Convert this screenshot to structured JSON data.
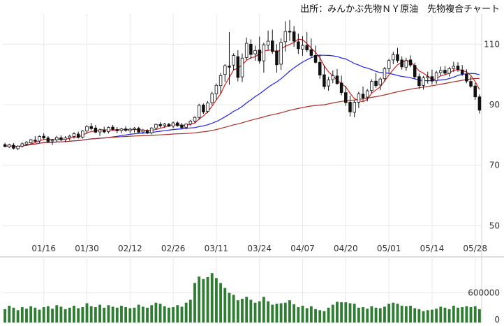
{
  "source": "出所：みんかぶ先物ＮＹ原油　先物複合チャート",
  "chart_data": {
    "type": "candlestick",
    "title": "",
    "price_axis": {
      "ticks": [
        50,
        70,
        90,
        110
      ],
      "ylim": [
        42,
        120
      ]
    },
    "volume_axis": {
      "ticks": [
        0,
        600000
      ],
      "ylim": [
        0,
        1300000
      ]
    },
    "x_ticks": [
      "01/16",
      "01/30",
      "02/12",
      "02/26",
      "03/11",
      "03/24",
      "04/07",
      "04/20",
      "05/01",
      "05/14",
      "05/28"
    ],
    "x_tick_indices": [
      9,
      19,
      29,
      39,
      49,
      59,
      69,
      79,
      89,
      99,
      109
    ],
    "candles": [
      [
        0,
        76.8,
        77.4,
        75.9,
        76.2
      ],
      [
        1,
        76.0,
        77.1,
        75.7,
        76.8
      ],
      [
        2,
        76.6,
        77.3,
        75.2,
        75.6
      ],
      [
        3,
        75.5,
        76.6,
        75.0,
        76.3
      ],
      [
        4,
        76.3,
        77.6,
        75.8,
        77.1
      ],
      [
        5,
        77.0,
        78.0,
        76.4,
        77.6
      ],
      [
        6,
        77.4,
        78.7,
        77.0,
        78.4
      ],
      [
        7,
        78.3,
        79.6,
        77.6,
        77.9
      ],
      [
        8,
        78.0,
        79.8,
        77.4,
        79.5
      ],
      [
        9,
        79.6,
        80.6,
        78.6,
        79.0
      ],
      [
        10,
        79.0,
        79.6,
        77.6,
        77.8
      ],
      [
        11,
        78.0,
        78.7,
        76.7,
        78.3
      ],
      [
        12,
        78.4,
        79.7,
        77.6,
        79.2
      ],
      [
        13,
        79.1,
        79.9,
        78.0,
        78.4
      ],
      [
        14,
        78.5,
        79.6,
        77.6,
        79.0
      ],
      [
        15,
        79.0,
        80.1,
        78.2,
        79.6
      ],
      [
        16,
        79.5,
        80.9,
        78.8,
        80.4
      ],
      [
        17,
        80.3,
        81.1,
        78.8,
        79.2
      ],
      [
        18,
        79.3,
        81.6,
        78.8,
        81.3
      ],
      [
        19,
        81.3,
        83.2,
        80.4,
        82.8
      ],
      [
        20,
        82.8,
        84.0,
        81.6,
        82.1
      ],
      [
        21,
        82.3,
        83.3,
        80.6,
        80.9
      ],
      [
        22,
        81.0,
        82.1,
        79.7,
        81.7
      ],
      [
        23,
        81.6,
        82.7,
        80.6,
        81.0
      ],
      [
        24,
        81.1,
        82.8,
        80.5,
        82.5
      ],
      [
        25,
        82.6,
        83.3,
        81.4,
        81.8
      ],
      [
        26,
        81.8,
        82.6,
        80.6,
        81.4
      ],
      [
        27,
        81.5,
        82.3,
        80.6,
        82.0
      ],
      [
        28,
        82.0,
        82.9,
        81.1,
        81.5
      ],
      [
        29,
        81.4,
        82.4,
        80.6,
        81.9
      ],
      [
        30,
        81.9,
        82.6,
        80.8,
        82.3
      ],
      [
        31,
        82.2,
        82.7,
        80.7,
        80.9
      ],
      [
        32,
        81.0,
        82.0,
        80.4,
        81.6
      ],
      [
        33,
        81.5,
        81.9,
        80.3,
        80.6
      ],
      [
        34,
        80.7,
        82.6,
        80.2,
        82.3
      ],
      [
        35,
        82.3,
        83.8,
        81.8,
        83.5
      ],
      [
        36,
        83.5,
        84.2,
        82.4,
        83.0
      ],
      [
        37,
        83.1,
        84.0,
        82.3,
        83.6
      ],
      [
        38,
        83.5,
        84.0,
        82.6,
        82.9
      ],
      [
        39,
        82.9,
        84.4,
        82.2,
        84.0
      ],
      [
        40,
        84.0,
        84.5,
        82.7,
        83.1
      ],
      [
        41,
        83.3,
        84.0,
        82.0,
        82.4
      ],
      [
        42,
        82.5,
        83.8,
        81.9,
        83.6
      ],
      [
        43,
        83.6,
        85.0,
        83.0,
        84.6
      ],
      [
        44,
        84.6,
        86.2,
        84.0,
        85.8
      ],
      [
        45,
        85.8,
        90.3,
        85.0,
        89.8
      ],
      [
        46,
        89.9,
        90.4,
        87.0,
        87.6
      ],
      [
        47,
        87.8,
        91.2,
        87.2,
        90.6
      ],
      [
        48,
        90.7,
        94.3,
        89.9,
        93.6
      ],
      [
        49,
        93.6,
        97.0,
        91.6,
        96.4
      ],
      [
        50,
        96.3,
        100.5,
        93.6,
        99.6
      ],
      [
        51,
        100.0,
        103.4,
        97.6,
        102.9
      ],
      [
        52,
        102.8,
        114.0,
        96.6,
        102.4
      ],
      [
        53,
        103.1,
        107.0,
        101.5,
        106.3
      ],
      [
        54,
        105.9,
        108.0,
        97.7,
        99.0
      ],
      [
        55,
        99.2,
        106.9,
        97.5,
        105.4
      ],
      [
        56,
        105.6,
        112.2,
        104.8,
        110.3
      ],
      [
        57,
        110.0,
        111.6,
        105.1,
        106.6
      ],
      [
        58,
        106.8,
        109.5,
        104.5,
        107.9
      ],
      [
        59,
        108.1,
        112.5,
        103.6,
        104.5
      ],
      [
        60,
        104.5,
        110.5,
        100.6,
        109.8
      ],
      [
        61,
        109.7,
        114.5,
        108.0,
        111.0
      ],
      [
        62,
        111.1,
        114.8,
        106.8,
        107.6
      ],
      [
        63,
        107.8,
        110.0,
        100.6,
        103.2
      ],
      [
        64,
        103.4,
        111.9,
        101.5,
        110.6
      ],
      [
        65,
        110.8,
        117.6,
        107.6,
        114.2
      ],
      [
        66,
        114.3,
        118.0,
        111.1,
        114.0
      ],
      [
        67,
        114.1,
        116.0,
        109.1,
        111.0
      ],
      [
        68,
        110.8,
        113.5,
        106.8,
        108.5
      ],
      [
        69,
        108.4,
        112.7,
        106.2,
        109.6
      ],
      [
        70,
        109.6,
        114.0,
        107.4,
        108.1
      ],
      [
        71,
        108.2,
        111.9,
        105.8,
        106.3
      ],
      [
        72,
        106.3,
        109.5,
        103.6,
        104.0
      ],
      [
        73,
        104.0,
        106.6,
        98.6,
        99.8
      ],
      [
        74,
        99.9,
        103.0,
        95.1,
        96.0
      ],
      [
        75,
        96.2,
        99.2,
        94.6,
        98.2
      ],
      [
        76,
        98.3,
        101.3,
        97.1,
        99.6
      ],
      [
        77,
        99.5,
        101.8,
        96.6,
        97.0
      ],
      [
        78,
        97.2,
        99.6,
        93.1,
        94.0
      ],
      [
        79,
        94.0,
        96.2,
        89.6,
        90.7
      ],
      [
        80,
        90.8,
        93.0,
        86.1,
        87.6
      ],
      [
        81,
        87.5,
        91.5,
        85.8,
        90.8
      ],
      [
        82,
        90.8,
        94.3,
        88.9,
        93.6
      ],
      [
        83,
        93.5,
        96.0,
        91.2,
        92.3
      ],
      [
        84,
        92.5,
        95.2,
        91.1,
        94.6
      ],
      [
        85,
        94.7,
        98.4,
        93.8,
        97.7
      ],
      [
        86,
        97.8,
        100.4,
        95.6,
        96.3
      ],
      [
        87,
        96.5,
        99.1,
        94.8,
        98.5
      ],
      [
        88,
        98.6,
        102.5,
        97.6,
        101.9
      ],
      [
        89,
        101.9,
        105.2,
        100.6,
        104.6
      ],
      [
        90,
        104.8,
        107.5,
        103.4,
        106.5
      ],
      [
        91,
        106.6,
        108.8,
        103.9,
        104.6
      ],
      [
        92,
        104.8,
        106.0,
        101.6,
        102.5
      ],
      [
        93,
        102.4,
        105.5,
        101.2,
        104.6
      ],
      [
        94,
        104.8,
        106.3,
        102.4,
        103.1
      ],
      [
        95,
        103.0,
        103.9,
        98.4,
        99.2
      ],
      [
        96,
        99.3,
        100.3,
        95.2,
        96.3
      ],
      [
        97,
        96.4,
        99.5,
        95.0,
        98.9
      ],
      [
        98,
        98.9,
        100.9,
        97.0,
        99.3
      ],
      [
        99,
        99.3,
        101.6,
        96.7,
        97.8
      ],
      [
        100,
        97.9,
        101.2,
        96.9,
        100.6
      ],
      [
        101,
        100.6,
        102.6,
        99.6,
        101.3
      ],
      [
        102,
        101.4,
        102.8,
        99.8,
        100.4
      ],
      [
        103,
        100.4,
        102.5,
        99.3,
        101.9
      ],
      [
        104,
        101.9,
        104.2,
        100.8,
        102.7
      ],
      [
        105,
        102.8,
        104.0,
        100.9,
        101.6
      ],
      [
        106,
        101.5,
        103.1,
        99.5,
        100.2
      ],
      [
        107,
        100.1,
        101.7,
        97.1,
        97.8
      ],
      [
        108,
        97.7,
        99.3,
        95.6,
        96.1
      ],
      [
        109,
        96.2,
        97.2,
        91.6,
        92.6
      ],
      [
        110,
        92.6,
        93.4,
        87.1,
        88.2
      ]
    ],
    "volume": [
      [
        0,
        270000
      ],
      [
        1,
        340000
      ],
      [
        2,
        300000
      ],
      [
        3,
        250000
      ],
      [
        4,
        310000
      ],
      [
        5,
        280000
      ],
      [
        6,
        330000
      ],
      [
        7,
        300000
      ],
      [
        8,
        260000
      ],
      [
        9,
        310000
      ],
      [
        10,
        330000
      ],
      [
        11,
        280000
      ],
      [
        12,
        350000
      ],
      [
        13,
        320000
      ],
      [
        14,
        270000
      ],
      [
        15,
        300000
      ],
      [
        16,
        340000
      ],
      [
        17,
        290000
      ],
      [
        18,
        310000
      ],
      [
        19,
        390000
      ],
      [
        20,
        330000
      ],
      [
        21,
        310000
      ],
      [
        22,
        360000
      ],
      [
        23,
        300000
      ],
      [
        24,
        350000
      ],
      [
        25,
        320000
      ],
      [
        26,
        300000
      ],
      [
        27,
        340000
      ],
      [
        28,
        310000
      ],
      [
        29,
        290000
      ],
      [
        30,
        300000
      ],
      [
        31,
        360000
      ],
      [
        32,
        320000
      ],
      [
        33,
        300000
      ],
      [
        34,
        350000
      ],
      [
        35,
        400000
      ],
      [
        36,
        380000
      ],
      [
        37,
        330000
      ],
      [
        38,
        300000
      ],
      [
        39,
        310000
      ],
      [
        40,
        350000
      ],
      [
        41,
        320000
      ],
      [
        42,
        400000
      ],
      [
        43,
        460000
      ],
      [
        44,
        800000
      ],
      [
        45,
        930000
      ],
      [
        46,
        880000
      ],
      [
        47,
        920000
      ],
      [
        48,
        1000000
      ],
      [
        49,
        900000
      ],
      [
        50,
        800000
      ],
      [
        51,
        700000
      ],
      [
        52,
        600000
      ],
      [
        53,
        560000
      ],
      [
        54,
        450000
      ],
      [
        55,
        480000
      ],
      [
        56,
        520000
      ],
      [
        57,
        460000
      ],
      [
        58,
        400000
      ],
      [
        59,
        430000
      ],
      [
        60,
        520000
      ],
      [
        61,
        430000
      ],
      [
        62,
        360000
      ],
      [
        63,
        380000
      ],
      [
        64,
        390000
      ],
      [
        65,
        400000
      ],
      [
        66,
        450000
      ],
      [
        67,
        370000
      ],
      [
        68,
        310000
      ],
      [
        69,
        340000
      ],
      [
        70,
        290000
      ],
      [
        71,
        330000
      ],
      [
        72,
        270000
      ],
      [
        73,
        250000
      ],
      [
        74,
        230000
      ],
      [
        75,
        300000
      ],
      [
        76,
        360000
      ],
      [
        77,
        420000
      ],
      [
        78,
        410000
      ],
      [
        79,
        410000
      ],
      [
        80,
        390000
      ],
      [
        81,
        380000
      ],
      [
        82,
        300000
      ],
      [
        83,
        310000
      ],
      [
        84,
        280000
      ],
      [
        85,
        330000
      ],
      [
        86,
        300000
      ],
      [
        87,
        290000
      ],
      [
        88,
        320000
      ],
      [
        89,
        380000
      ],
      [
        90,
        400000
      ],
      [
        91,
        380000
      ],
      [
        92,
        340000
      ],
      [
        93,
        330000
      ],
      [
        94,
        340000
      ],
      [
        95,
        290000
      ],
      [
        96,
        270000
      ],
      [
        97,
        230000
      ],
      [
        98,
        250000
      ],
      [
        99,
        260000
      ],
      [
        100,
        280000
      ],
      [
        101,
        320000
      ],
      [
        102,
        300000
      ],
      [
        103,
        270000
      ],
      [
        104,
        340000
      ],
      [
        105,
        300000
      ],
      [
        106,
        310000
      ],
      [
        107,
        330000
      ],
      [
        108,
        310000
      ],
      [
        109,
        330000
      ],
      [
        110,
        270000
      ]
    ],
    "ma_lines": [
      {
        "color": "#d42020"
      },
      {
        "color": "#2020e0"
      },
      {
        "color": "#a03028"
      }
    ],
    "colors": {
      "up_fill": "#ffffff",
      "down_fill": "#111111",
      "candle_stroke": "#111111",
      "volume_bar": "#2e7d32",
      "grid": "#e8e8e8"
    }
  }
}
